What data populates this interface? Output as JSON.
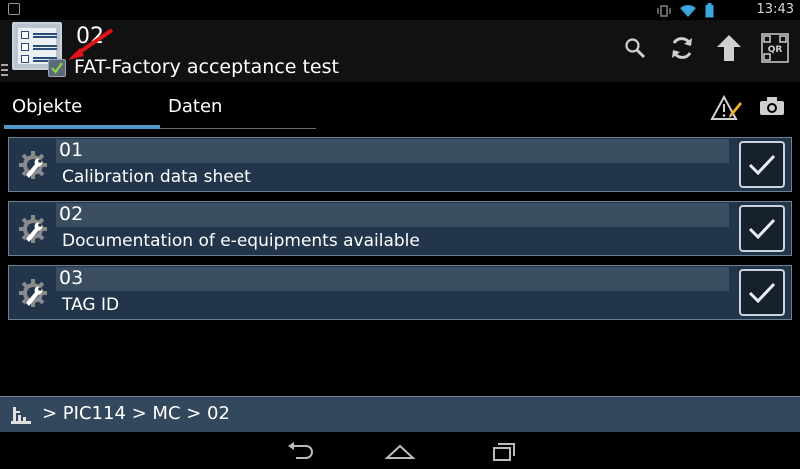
{
  "status_bar": {
    "time": "13:43",
    "icons": [
      "notification-icon",
      "vibrate-icon",
      "wifi-icon",
      "battery-icon"
    ]
  },
  "header": {
    "number": "02",
    "subtitle": "FAT-Factory acceptance test",
    "actions": [
      "search-icon",
      "sync-icon",
      "upload-icon",
      "qr-code-icon"
    ],
    "qr_label": "QR"
  },
  "tabs": [
    {
      "label": "Objekte",
      "active": true
    },
    {
      "label": "Daten",
      "active": false
    }
  ],
  "items": [
    {
      "number": "01",
      "description": "Calibration data sheet",
      "checked": true
    },
    {
      "number": "02",
      "description": "Documentation of e-equipments available",
      "checked": true
    },
    {
      "number": "03",
      "description": "TAG ID",
      "checked": true
    }
  ],
  "breadcrumb": "> PIC114 > MC > 02",
  "colors": {
    "accent": "#4f97c9",
    "item_bg": "#22354a",
    "item_band": "#3c4e62",
    "breadcrumb_bg": "#34485d",
    "arrow": "#e0141a",
    "check_green": "#8ed04a"
  }
}
